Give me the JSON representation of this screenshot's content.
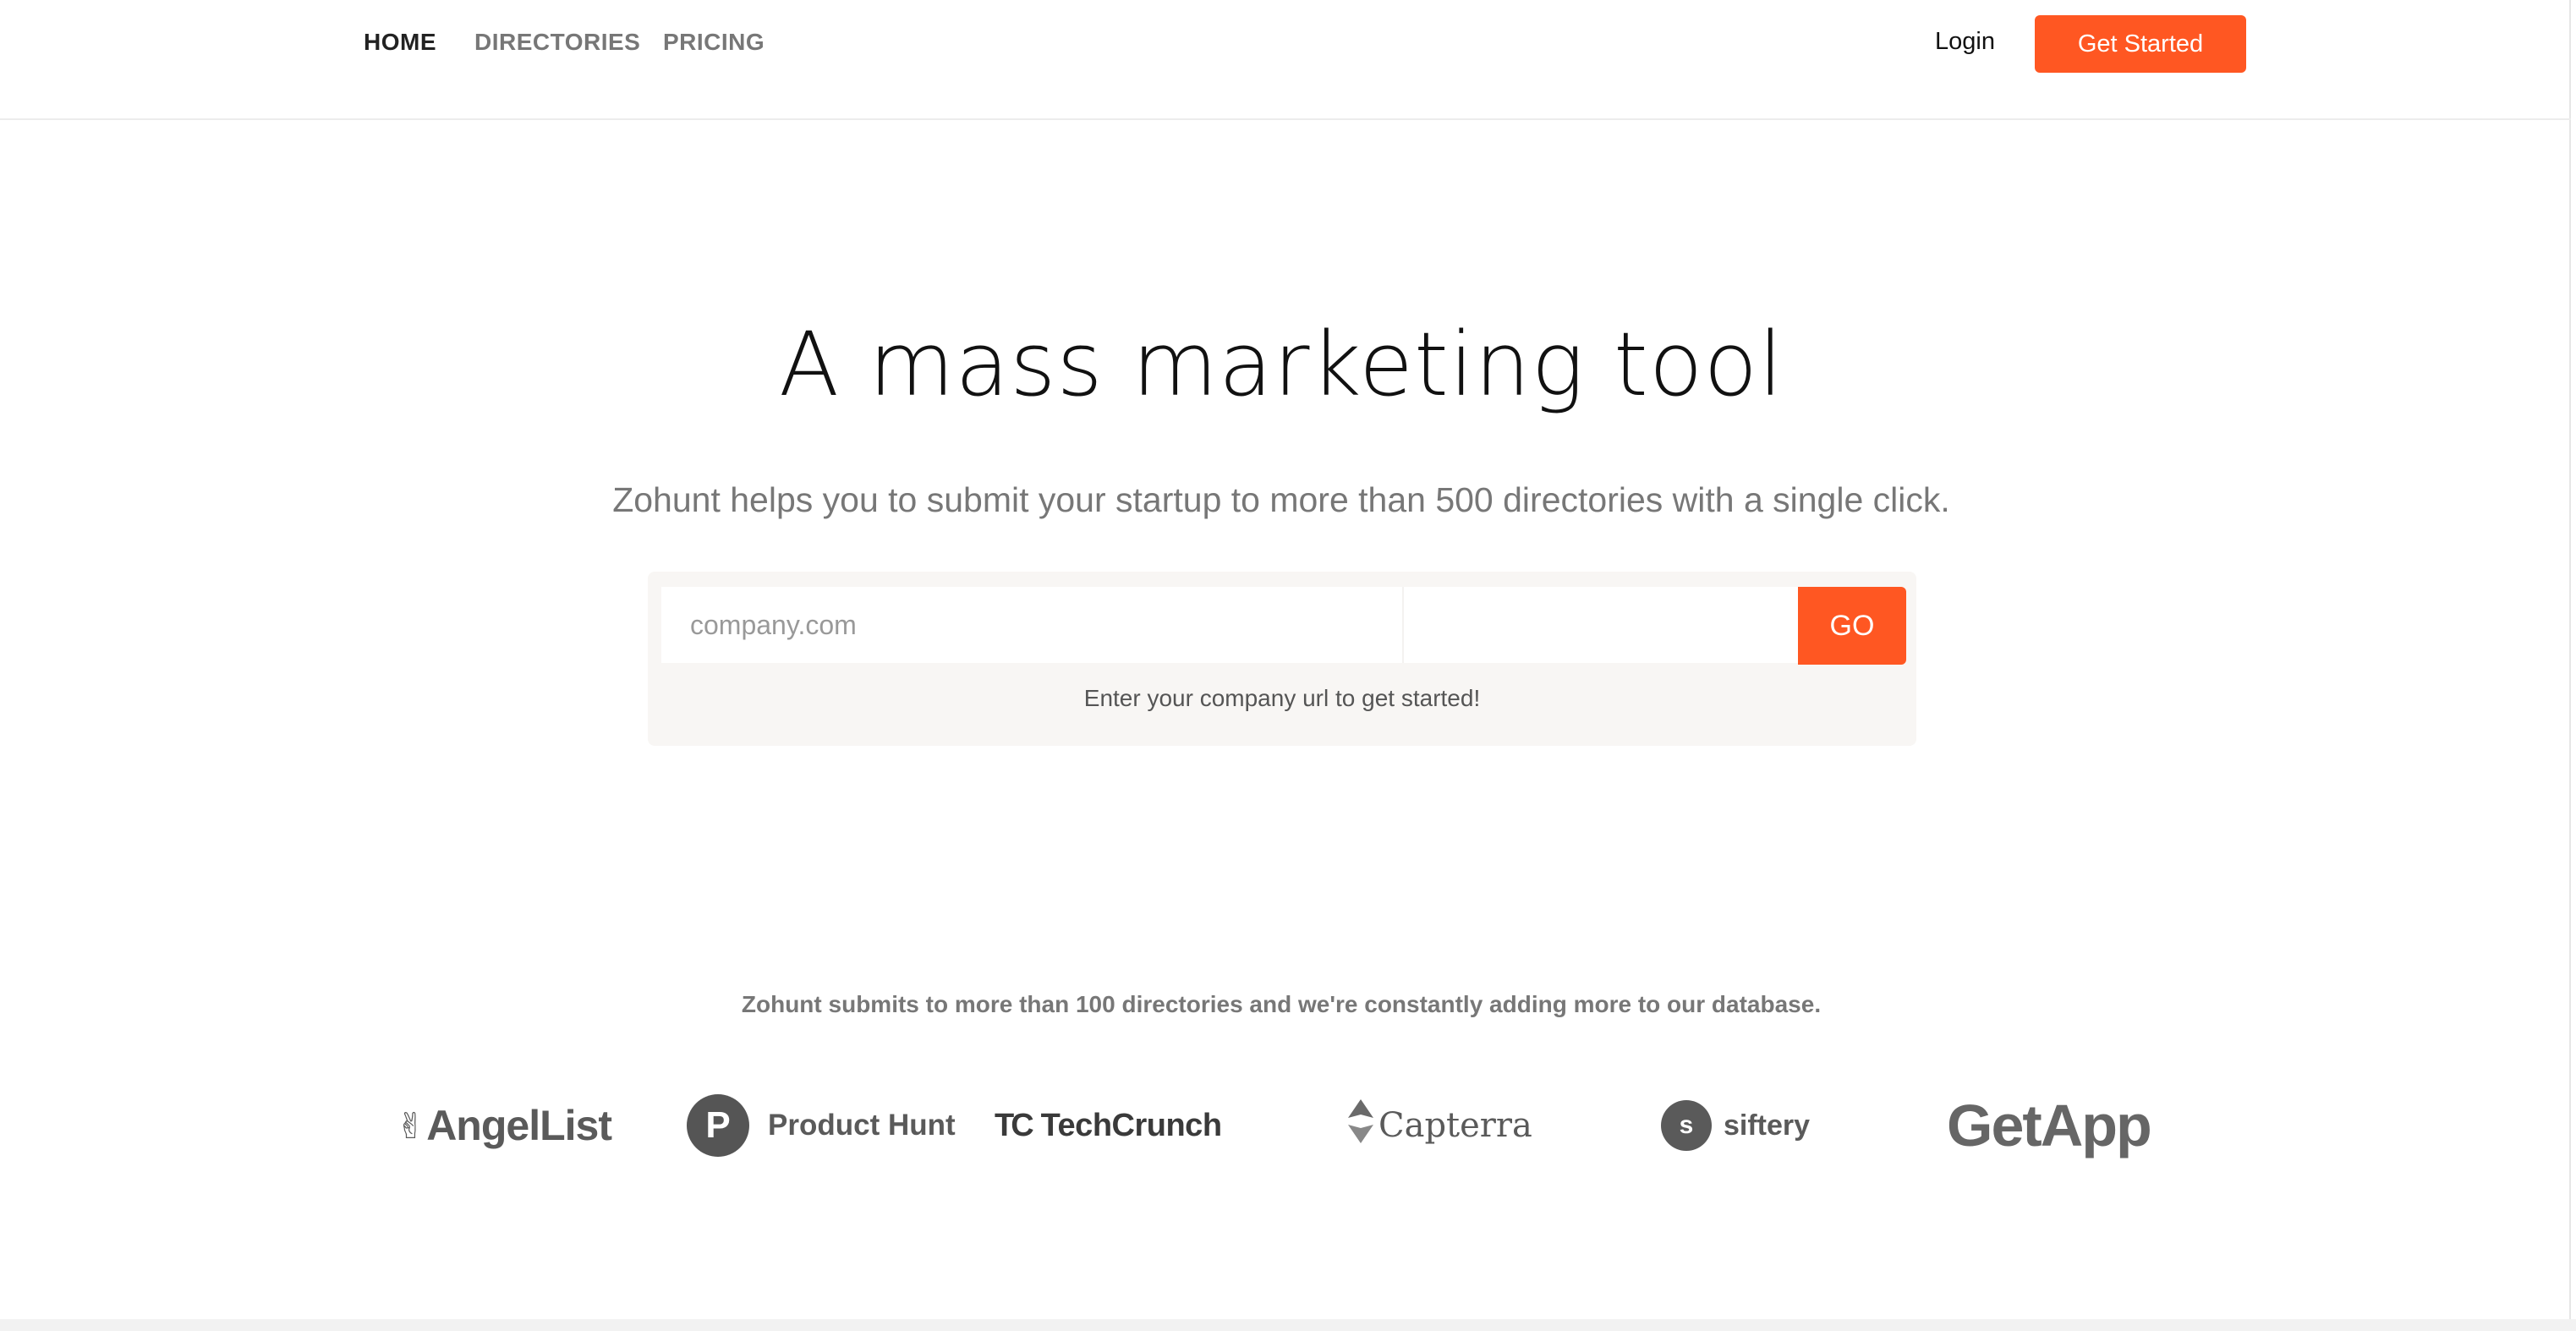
{
  "nav": {
    "items": [
      {
        "label": "HOME",
        "active": true
      },
      {
        "label": "DIRECTORIES",
        "active": false
      },
      {
        "label": "PRICING",
        "active": false
      }
    ],
    "login_label": "Login",
    "cta_label": "Get Started"
  },
  "hero": {
    "title": "A mass marketing tool",
    "subtitle": "Zohunt helps you to submit your startup to more than 500 directories with a single click."
  },
  "signup_form": {
    "url_placeholder": "company.com",
    "url_value": "",
    "go_label": "GO",
    "hint": "Enter your company url to get started!"
  },
  "directories": {
    "caption": "Zohunt submits to more than 100 directories and we're constantly adding more to our database.",
    "logos": [
      {
        "name": "AngelList",
        "icon": "victory-hand-icon",
        "text": "AngelList"
      },
      {
        "name": "Product Hunt",
        "icon": "product-hunt-p-icon",
        "mark": "P",
        "text": "Product Hunt"
      },
      {
        "name": "TechCrunch",
        "icon": "techcrunch-tc-icon",
        "mark": "TC",
        "text": "TechCrunch"
      },
      {
        "name": "Capterra",
        "icon": "capterra-arrow-icon",
        "text": "Capterra"
      },
      {
        "name": "siftery",
        "icon": "siftery-s-icon",
        "mark": "s",
        "text": "siftery"
      },
      {
        "name": "GetApp",
        "text": "GetApp"
      }
    ]
  },
  "colors": {
    "accent": "#ff5722",
    "text_dark": "#111111",
    "text_muted": "#777777",
    "panel_bg": "#f8f6f4",
    "logo_gray": "#5a5a5a"
  }
}
